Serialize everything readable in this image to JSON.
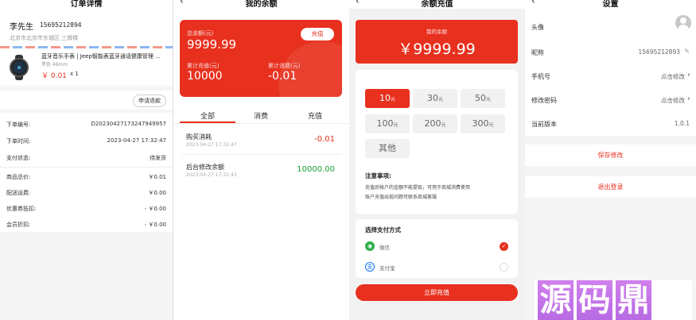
{
  "order": {
    "title": "订单详情",
    "name": "李先生",
    "phone": "15695212894",
    "address": "北京市北京市东城区 三牌楼",
    "product_title": "蓝牙音乐手表 | Jeep智能表蓝牙通话健康管理 ...",
    "product_spec": "黑色 46mm",
    "price": "￥ 0.01",
    "qty": "x 1",
    "refund_button": "申请退款",
    "rows": [
      {
        "label": "下单编号:",
        "value": "D20230427173247949957"
      },
      {
        "label": "下单时间:",
        "value": "2023-04-27 17:32:47"
      },
      {
        "label": "支付状态:",
        "value": "待发货"
      },
      {
        "label": "商品总价:",
        "value": "￥0.01"
      },
      {
        "label": "配送运费:",
        "value": "￥0.00"
      },
      {
        "label": "优惠券抵扣:",
        "value": "- ￥0.00"
      },
      {
        "label": "会员折扣:",
        "value": "- ￥0.00"
      }
    ]
  },
  "balance": {
    "title": "我的余额",
    "total_label": "总余额(元)",
    "total_value": "9999.99",
    "recharge_button": "充值",
    "recharged_label": "累计充值(元)",
    "recharged_value": "10000",
    "spent_label": "累计消费(元)",
    "spent_value": "-0.01",
    "tabs": [
      "全部",
      "消费",
      "充值"
    ],
    "records": [
      {
        "title": "购买消耗",
        "time": "2023-04-27 17:32:47",
        "amount": "-0.01"
      },
      {
        "title": "后台修改余额",
        "time": "2023-04-27 17:32:43",
        "amount": "10000.00"
      }
    ]
  },
  "recharge": {
    "title": "余额充值",
    "my_balance_label": "我的余额",
    "my_balance_value": "￥9999.99",
    "amounts": [
      {
        "value": "10",
        "unit": "元"
      },
      {
        "value": "30",
        "unit": "元"
      },
      {
        "value": "50",
        "unit": "元"
      },
      {
        "value": "100",
        "unit": "元"
      },
      {
        "value": "200",
        "unit": "元"
      },
      {
        "value": "300",
        "unit": "元"
      }
    ],
    "other": "其他",
    "notice_title": "注意事项:",
    "notice_line1": "充值后帐户的金额不能提现，可用于商城消费使用",
    "notice_line2": "账户充值出现问题可联系商城客服",
    "pay_title": "选择支付方式",
    "pay_wechat": "微信",
    "pay_alipay": "支付宝",
    "submit": "立即充值"
  },
  "settings": {
    "title": "设置",
    "avatar_label": "头像",
    "nickname_label": "昵称",
    "nickname_value": "15695212893",
    "phone_label": "手机号",
    "phone_action": "点击修改",
    "password_label": "修改密码",
    "password_action": "点击修改",
    "version_label": "当前版本",
    "version_value": "1.0.1",
    "save": "保存修改",
    "logout": "退出登录"
  },
  "watermark": [
    "源",
    "码",
    "鼎"
  ],
  "colors": {
    "accent": "#e8301e",
    "green": "#19a033"
  }
}
